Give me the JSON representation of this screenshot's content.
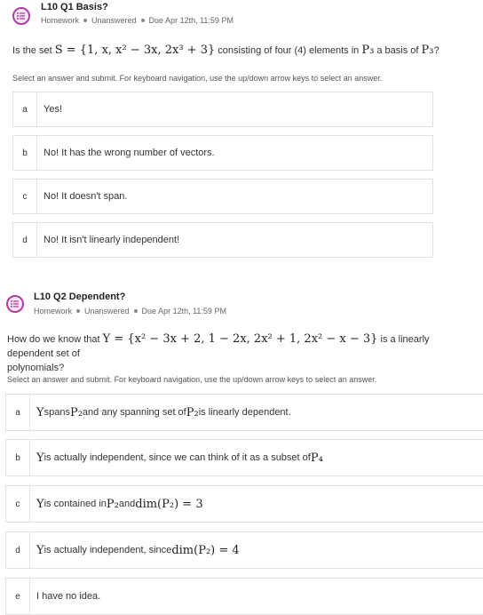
{
  "q1": {
    "title": "L10 Q1 Basis?",
    "meta": [
      "Homework",
      "Unanswered",
      "Due Apr 12th, 11:59 PM"
    ],
    "prompt_pre": "Is the set ",
    "prompt_math": "S = {1, x, x² − 3x, 2x³ + 3}",
    "prompt_mid": " consisting of four (4) elements in ",
    "prompt_math2": "P₃",
    "prompt_mid2": " a basis of ",
    "prompt_math3": "P₃",
    "prompt_end": "?",
    "select_hint": "Select an answer and submit. For keyboard navigation, use the up/down arrow keys to select an answer.",
    "options": [
      {
        "letter": "a",
        "text": "Yes!"
      },
      {
        "letter": "b",
        "text": "No! It has the wrong number of vectors."
      },
      {
        "letter": "c",
        "text": "No! It doesn't span."
      },
      {
        "letter": "d",
        "text": "No! It isn't linearly independent!"
      }
    ]
  },
  "q2": {
    "title": "L10 Q2 Dependent?",
    "meta": [
      "Homework",
      "Unanswered",
      "Due Apr 12th, 11:59 PM"
    ],
    "prompt_pre": "How do we know that ",
    "prompt_math": "Y = {x² − 3x + 2, 1 − 2x, 2x² + 1, 2x² − x − 3}",
    "prompt_mid": " is a linearly dependent set of",
    "prompt_line2": "polynomials?",
    "select_hint": "Select an answer and submit. For keyboard navigation, use the up/down arrow keys to select an answer.",
    "options": [
      {
        "letter": "a",
        "m1": "Y",
        "t1": " spans ",
        "m2": "P₂",
        "t2": " and any spanning set of ",
        "m3": "P₂",
        "t3": " is linearly dependent."
      },
      {
        "letter": "b",
        "m1": "Y",
        "t1": " is actually independent, since we can think of it as a subset of ",
        "m2": "P₄",
        "t2": "",
        "m3": "",
        "t3": ""
      },
      {
        "letter": "c",
        "m1": "Y",
        "t1": " is contained in ",
        "m2": "P₂",
        "t2": " and ",
        "m3": "dim(P₂) = 3",
        "t3": ""
      },
      {
        "letter": "d",
        "m1": "Y",
        "t1": " is actually independent, since ",
        "m2": "dim(P₂) = 4",
        "t2": "",
        "m3": "",
        "t3": ""
      },
      {
        "letter": "e",
        "m1": "",
        "t1": "I have no idea.",
        "m2": "",
        "t2": "",
        "m3": "",
        "t3": ""
      }
    ]
  },
  "colors": {
    "accent": "#b13da3",
    "accent_bg": "#f6e6f4",
    "border": "#e2e2e2"
  }
}
